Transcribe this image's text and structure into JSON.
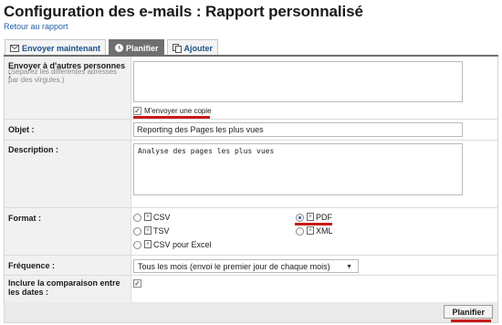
{
  "page": {
    "title": "Configuration des e-mails : Rapport personnalisé",
    "back_link": "Retour au rapport"
  },
  "tabs": [
    {
      "label": "Envoyer maintenant",
      "icon": "envelope-icon",
      "active": false
    },
    {
      "label": "Planifier",
      "icon": "clock-icon",
      "active": true
    },
    {
      "label": "Ajouter",
      "icon": "add-copy-icon",
      "active": false
    }
  ],
  "form": {
    "recipients": {
      "label": "Envoyer à d'autres personnes :",
      "hint": "(Séparez les différentes adresses par des virgules.)",
      "value": "",
      "copy_checkbox": {
        "label": "M'envoyer une copie",
        "checked": true
      }
    },
    "subject": {
      "label": "Objet :",
      "value": "Reporting des Pages les plus vues"
    },
    "description": {
      "label": "Description :",
      "value": "Analyse des pages les plus vues"
    },
    "format": {
      "label": "Format :",
      "options": [
        {
          "label": "CSV",
          "selected": false,
          "icon": "csv-file-icon"
        },
        {
          "label": "PDF",
          "selected": true,
          "icon": "pdf-file-icon"
        },
        {
          "label": "TSV",
          "selected": false,
          "icon": "tsv-file-icon"
        },
        {
          "label": "XML",
          "selected": false,
          "icon": "xml-file-icon"
        },
        {
          "label": "CSV pour Excel",
          "selected": false,
          "icon": "excel-file-icon"
        }
      ]
    },
    "frequency": {
      "label": "Fréquence :",
      "value": "Tous les mois (envoi le premier jour de chaque mois)"
    },
    "compare": {
      "label": "Inclure la comparaison entre les dates :",
      "checked": true
    }
  },
  "actions": {
    "submit_label": "Planifier"
  },
  "colors": {
    "highlight": "#c81b1b",
    "link": "#1f5fa8",
    "active_tab": "#6f6f6f"
  }
}
